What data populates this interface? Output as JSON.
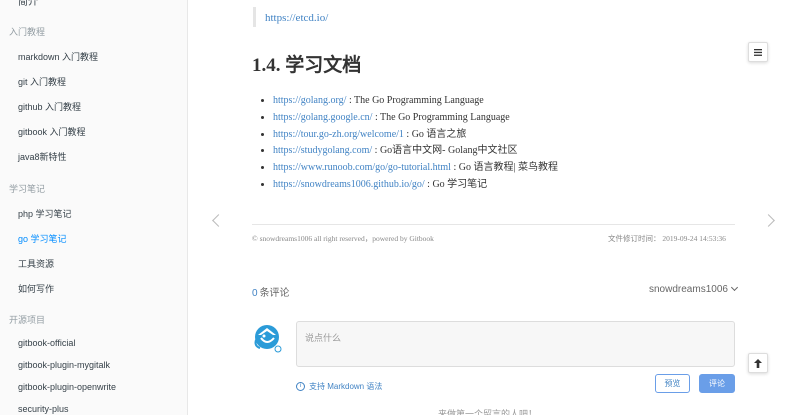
{
  "sidebar": {
    "top_partial": "简介",
    "sections": [
      {
        "header": "入门教程",
        "items": [
          {
            "label": "markdown 入门教程"
          },
          {
            "label": "git 入门教程"
          },
          {
            "label": "github 入门教程"
          },
          {
            "label": "gitbook 入门教程"
          },
          {
            "label": "java8新特性"
          }
        ]
      },
      {
        "header": "学习笔记",
        "items": [
          {
            "label": "php 学习笔记"
          },
          {
            "label": "go 学习笔记"
          },
          {
            "label": "工具资源"
          },
          {
            "label": "如何写作"
          }
        ]
      },
      {
        "header": "开源项目",
        "items": [
          {
            "label": "gitbook-official"
          },
          {
            "label": "gitbook-plugin-mygitalk"
          },
          {
            "label": "gitbook-plugin-openwrite"
          },
          {
            "label": "security-plus"
          }
        ]
      }
    ],
    "active_item": "go 学习笔记"
  },
  "content": {
    "quote_link": "https://etcd.io/",
    "section_title": "1.4. 学习文档",
    "links": [
      {
        "url": "https://golang.org/",
        "desc": " : The Go Programming Language"
      },
      {
        "url": "https://golang.google.cn/",
        "desc": " : The Go Programming Language"
      },
      {
        "url": "https://tour.go-zh.org/welcome/1",
        "desc": " : Go 语言之旅"
      },
      {
        "url": "https://studygolang.com/",
        "desc": " : Go语言中文网- Golang中文社区"
      },
      {
        "url": "https://www.runoob.com/go/go-tutorial.html",
        "desc": " : Go 语言教程| 菜鸟教程"
      },
      {
        "url": "https://snowdreams1006.github.io/go/",
        "desc": " : Go 学习笔记"
      }
    ],
    "footer_copyright": "© snowdreams1006 all right reserved，powered by Gitbook",
    "footer_modified": "文件修订时间： 2019-09-24 14:53:36"
  },
  "comments": {
    "count": "0",
    "count_label": "条评论",
    "user": "snowdreams1006",
    "placeholder": "说点什么",
    "markdown_hint": "支持 Markdown 语法",
    "preview_label": "预览",
    "submit_label": "评论",
    "cut_text": "来做第一个留言的人吧！"
  },
  "icons": {
    "menu": "menu-icon",
    "back_to_top": "arrow-up-icon",
    "prev": "chevron-left-icon",
    "next": "chevron-right-icon",
    "info": "info-icon",
    "avatar": "avatar-icon"
  },
  "colors": {
    "link": "#4183c4",
    "active": "#008cff",
    "button": "#6a9ee8"
  }
}
